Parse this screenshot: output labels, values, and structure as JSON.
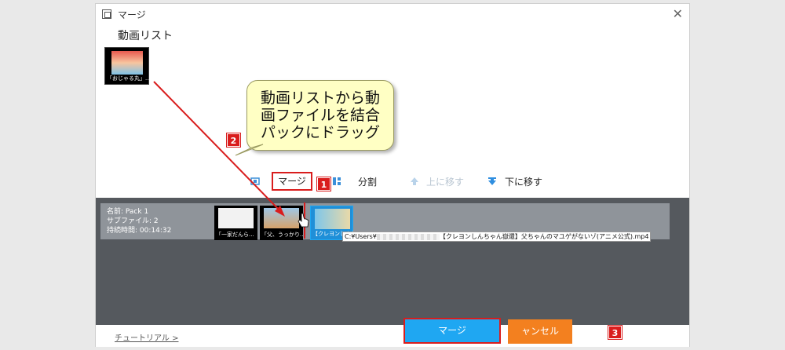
{
  "window": {
    "title": "マージ",
    "close_glyph": "✕"
  },
  "video_list": {
    "title": "動画リスト",
    "items": [
      {
        "caption": "「おじゃる丸」..."
      }
    ]
  },
  "callout": {
    "lines": [
      "動画リストから動",
      "画ファイルを結合",
      "パックにドラッグ"
    ]
  },
  "badges": [
    "1",
    "2",
    "3"
  ],
  "toolbar": {
    "merge_label": "マージ",
    "split_label": "分割",
    "move_up_label": "上に移す",
    "move_down_label": "下に移す"
  },
  "pack": {
    "name_line": "名前: Pack 1",
    "subfiles_line": "サブファイル: 2",
    "duration_line": "持続時間: 00:14:32",
    "clips": [
      {
        "caption": "「一家だんら...",
        "color": "#f2f2f2"
      },
      {
        "caption": "「父、うっかり...",
        "color": "#9fc7e6"
      },
      {
        "caption": "【クレヨンしんち",
        "color": "#7ec6ea"
      }
    ]
  },
  "tooltip": {
    "path_start": "C:¥Users¥",
    "path_end": "【クレヨンしんちゃん嶽還】父ちゃんのマユゲがないゾ(アニメ公式).mp4"
  },
  "footer": {
    "tutorial_link": "チュートリアル >",
    "merge_button": "マージ",
    "cancel_button": "ャンセル"
  },
  "colors": {
    "accent_blue": "#1fa7f2",
    "cancel_orange": "#f3801f",
    "annotation_red": "#d91d1d",
    "callout_yellow": "#ffffc4"
  }
}
